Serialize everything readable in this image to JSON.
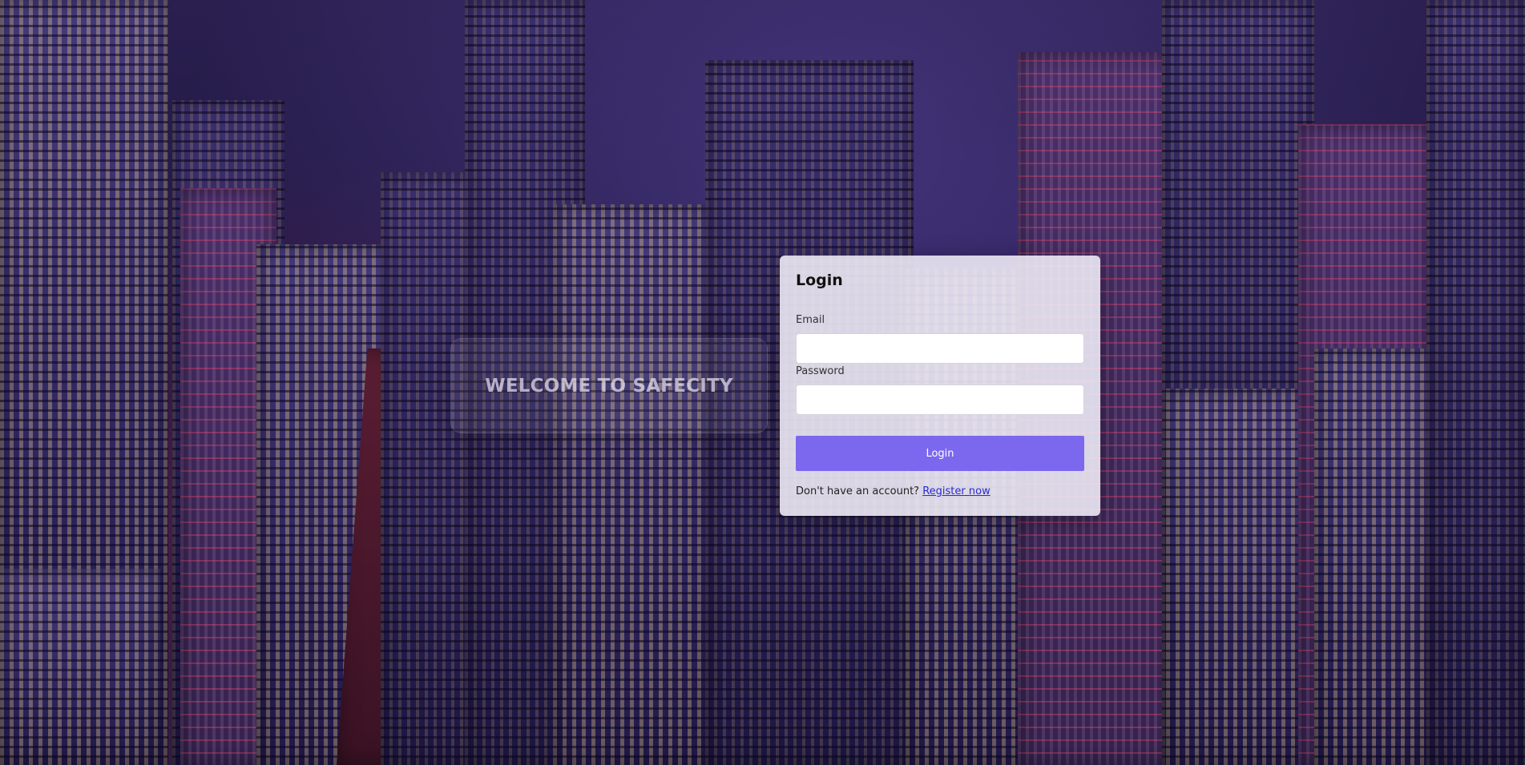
{
  "welcome": {
    "title": "WELCOME TO SAFECITY"
  },
  "login": {
    "title": "Login",
    "email_label": "Email",
    "email_value": "",
    "password_label": "Password",
    "password_value": "",
    "button_label": "Login",
    "register_prompt": "Don't have an account?",
    "register_link": "Register now"
  },
  "colors": {
    "accent": "#7b68ee",
    "link": "#2a2ad0"
  }
}
